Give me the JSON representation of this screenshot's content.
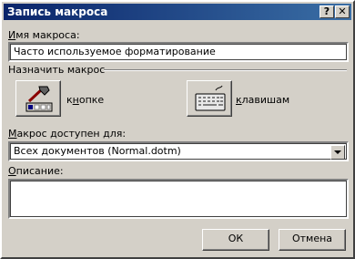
{
  "window": {
    "title": "Запись макроса",
    "help_label": "?",
    "close_label": "✕"
  },
  "macro_name": {
    "label_accel": "И",
    "label_rest": "мя макроса:",
    "value": "Часто используемое форматирование"
  },
  "assign": {
    "group_label": "Назначить макрос",
    "button_label_pre": "к",
    "button_label_accel": "н",
    "button_label_post": "опке",
    "keyboard_label_accel": "к",
    "keyboard_label_rest": "лавишам",
    "button_icon": "hammer-toolbar-icon",
    "keyboard_icon": "keyboard-icon"
  },
  "store_in": {
    "label_accel": "М",
    "label_rest": "акрос доступен для:",
    "selected": "Всех документов (Normal.dotm)"
  },
  "description": {
    "label_accel": "О",
    "label_rest": "писание:",
    "value": ""
  },
  "buttons": {
    "ok": "ОК",
    "cancel": "Отмена"
  },
  "colors": {
    "titlebar_start": "#0a246a",
    "titlebar_end": "#3a6ea5",
    "face": "#d4d0c8"
  }
}
